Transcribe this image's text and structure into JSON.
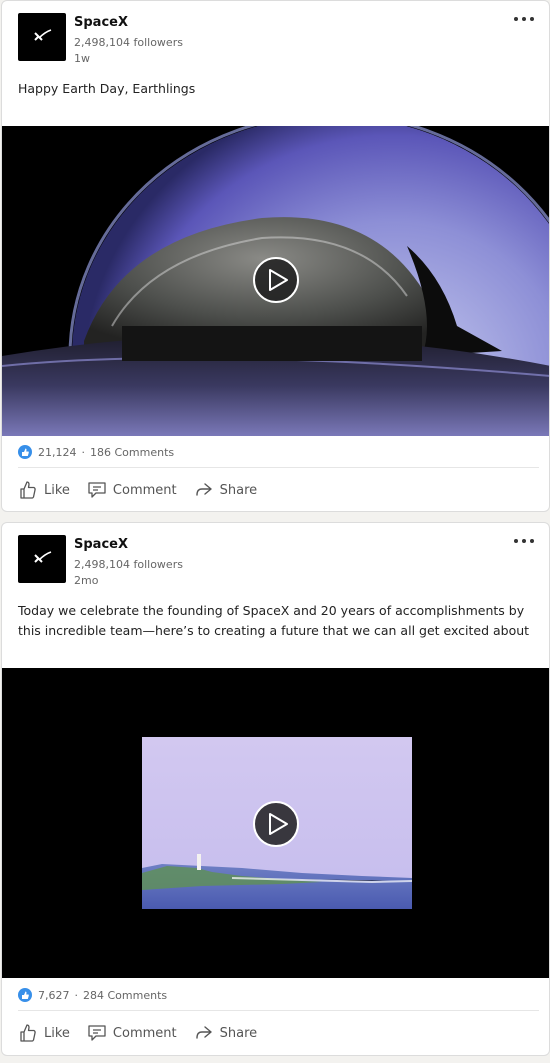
{
  "posts": [
    {
      "author": "SpaceX",
      "followers": "2,498,104 followers",
      "time": "1w",
      "text": "Happy Earth Day, Earthlings",
      "reactions": "21,124",
      "comments": "186 Comments",
      "actions": {
        "like": "Like",
        "comment": "Comment",
        "share": "Share"
      }
    },
    {
      "author": "SpaceX",
      "followers": "2,498,104 followers",
      "time": "2mo",
      "text": "Today we celebrate the founding of SpaceX and 20 years of accomplishments by this incredible team—here’s to creating a future that we can all get excited about",
      "reactions": "7,627",
      "comments": "284 Comments",
      "actions": {
        "like": "Like",
        "comment": "Comment",
        "share": "Share"
      }
    }
  ],
  "icons": {
    "logo": "spacex-logo",
    "more": "more-icon",
    "play": "play-icon",
    "like": "thumbs-up-icon",
    "comment": "comment-icon",
    "share": "share-icon"
  },
  "colors": {
    "accent": "#378fe9"
  }
}
